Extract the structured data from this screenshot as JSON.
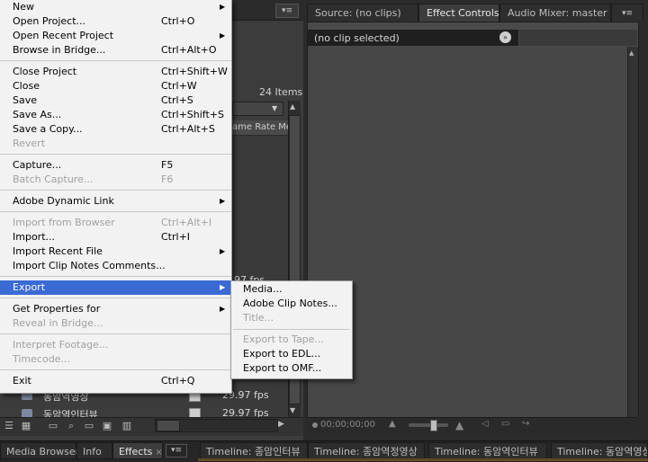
{
  "project_panel": {
    "items_count": "24 Items",
    "column_header": "ame Rate  Med",
    "partial_fps": "97 fps",
    "rows": [
      {
        "name": "동암역인터뷰",
        "fps": "29.97 fps"
      },
      {
        "name": "동암역영상",
        "fps": "29.97 fps"
      }
    ]
  },
  "right_panel": {
    "tabs": [
      {
        "label": "Source: (no clips)",
        "active": false
      },
      {
        "label": "Effect Controls",
        "active": true
      },
      {
        "label": "Audio Mixer: master",
        "active": false
      }
    ],
    "no_clip": "(no clip selected)",
    "timecode": "00;00;00;00"
  },
  "bottom_tabs": [
    {
      "label": "Media Browser",
      "active": false
    },
    {
      "label": "Info",
      "active": false
    },
    {
      "label": "Effects",
      "active": true
    },
    {
      "label": "Timeline: 종암인터뷰",
      "active": false
    },
    {
      "label": "Timeline: 종암역정영상",
      "active": false
    },
    {
      "label": "Timeline: 동암역인터뷰",
      "active": false
    },
    {
      "label": "Timeline: 동암역영상",
      "active": false
    }
  ],
  "file_menu": {
    "items": [
      {
        "label": "New",
        "shortcut": "",
        "submenu": true,
        "disabled": false
      },
      {
        "label": "Open Project...",
        "shortcut": "Ctrl+O",
        "submenu": false,
        "disabled": false
      },
      {
        "label": "Open Recent Project",
        "shortcut": "",
        "submenu": true,
        "disabled": false
      },
      {
        "label": "Browse in Bridge...",
        "shortcut": "Ctrl+Alt+O",
        "submenu": false,
        "disabled": false
      },
      {
        "label": "Close Project",
        "shortcut": "Ctrl+Shift+W",
        "submenu": false,
        "disabled": false
      },
      {
        "label": "Close",
        "shortcut": "Ctrl+W",
        "submenu": false,
        "disabled": false
      },
      {
        "label": "Save",
        "shortcut": "Ctrl+S",
        "submenu": false,
        "disabled": false
      },
      {
        "label": "Save As...",
        "shortcut": "Ctrl+Shift+S",
        "submenu": false,
        "disabled": false
      },
      {
        "label": "Save a Copy...",
        "shortcut": "Ctrl+Alt+S",
        "submenu": false,
        "disabled": false
      },
      {
        "label": "Revert",
        "shortcut": "",
        "submenu": false,
        "disabled": true
      },
      {
        "label": "Capture...",
        "shortcut": "F5",
        "submenu": false,
        "disabled": false
      },
      {
        "label": "Batch Capture...",
        "shortcut": "F6",
        "submenu": false,
        "disabled": true
      },
      {
        "label": "Adobe Dynamic Link",
        "shortcut": "",
        "submenu": true,
        "disabled": false
      },
      {
        "label": "Import from Browser",
        "shortcut": "Ctrl+Alt+I",
        "submenu": false,
        "disabled": true
      },
      {
        "label": "Import...",
        "shortcut": "Ctrl+I",
        "submenu": false,
        "disabled": false
      },
      {
        "label": "Import Recent File",
        "shortcut": "",
        "submenu": true,
        "disabled": false
      },
      {
        "label": "Import Clip Notes Comments...",
        "shortcut": "",
        "submenu": false,
        "disabled": false
      },
      {
        "label": "Export",
        "shortcut": "",
        "submenu": true,
        "disabled": false
      },
      {
        "label": "Get Properties for",
        "shortcut": "",
        "submenu": true,
        "disabled": false
      },
      {
        "label": "Reveal in Bridge...",
        "shortcut": "",
        "submenu": false,
        "disabled": true
      },
      {
        "label": "Interpret Footage...",
        "shortcut": "",
        "submenu": false,
        "disabled": true
      },
      {
        "label": "Timecode...",
        "shortcut": "",
        "submenu": false,
        "disabled": true
      },
      {
        "label": "Exit",
        "shortcut": "Ctrl+Q",
        "submenu": false,
        "disabled": false
      }
    ]
  },
  "export_menu": {
    "items": [
      {
        "label": "Media...",
        "disabled": false
      },
      {
        "label": "Adobe Clip Notes...",
        "disabled": false
      },
      {
        "label": "Title...",
        "disabled": true
      },
      {
        "label": "Export to Tape...",
        "disabled": true
      },
      {
        "label": "Export to EDL...",
        "disabled": false
      },
      {
        "label": "Export to OMF...",
        "disabled": false
      }
    ]
  }
}
